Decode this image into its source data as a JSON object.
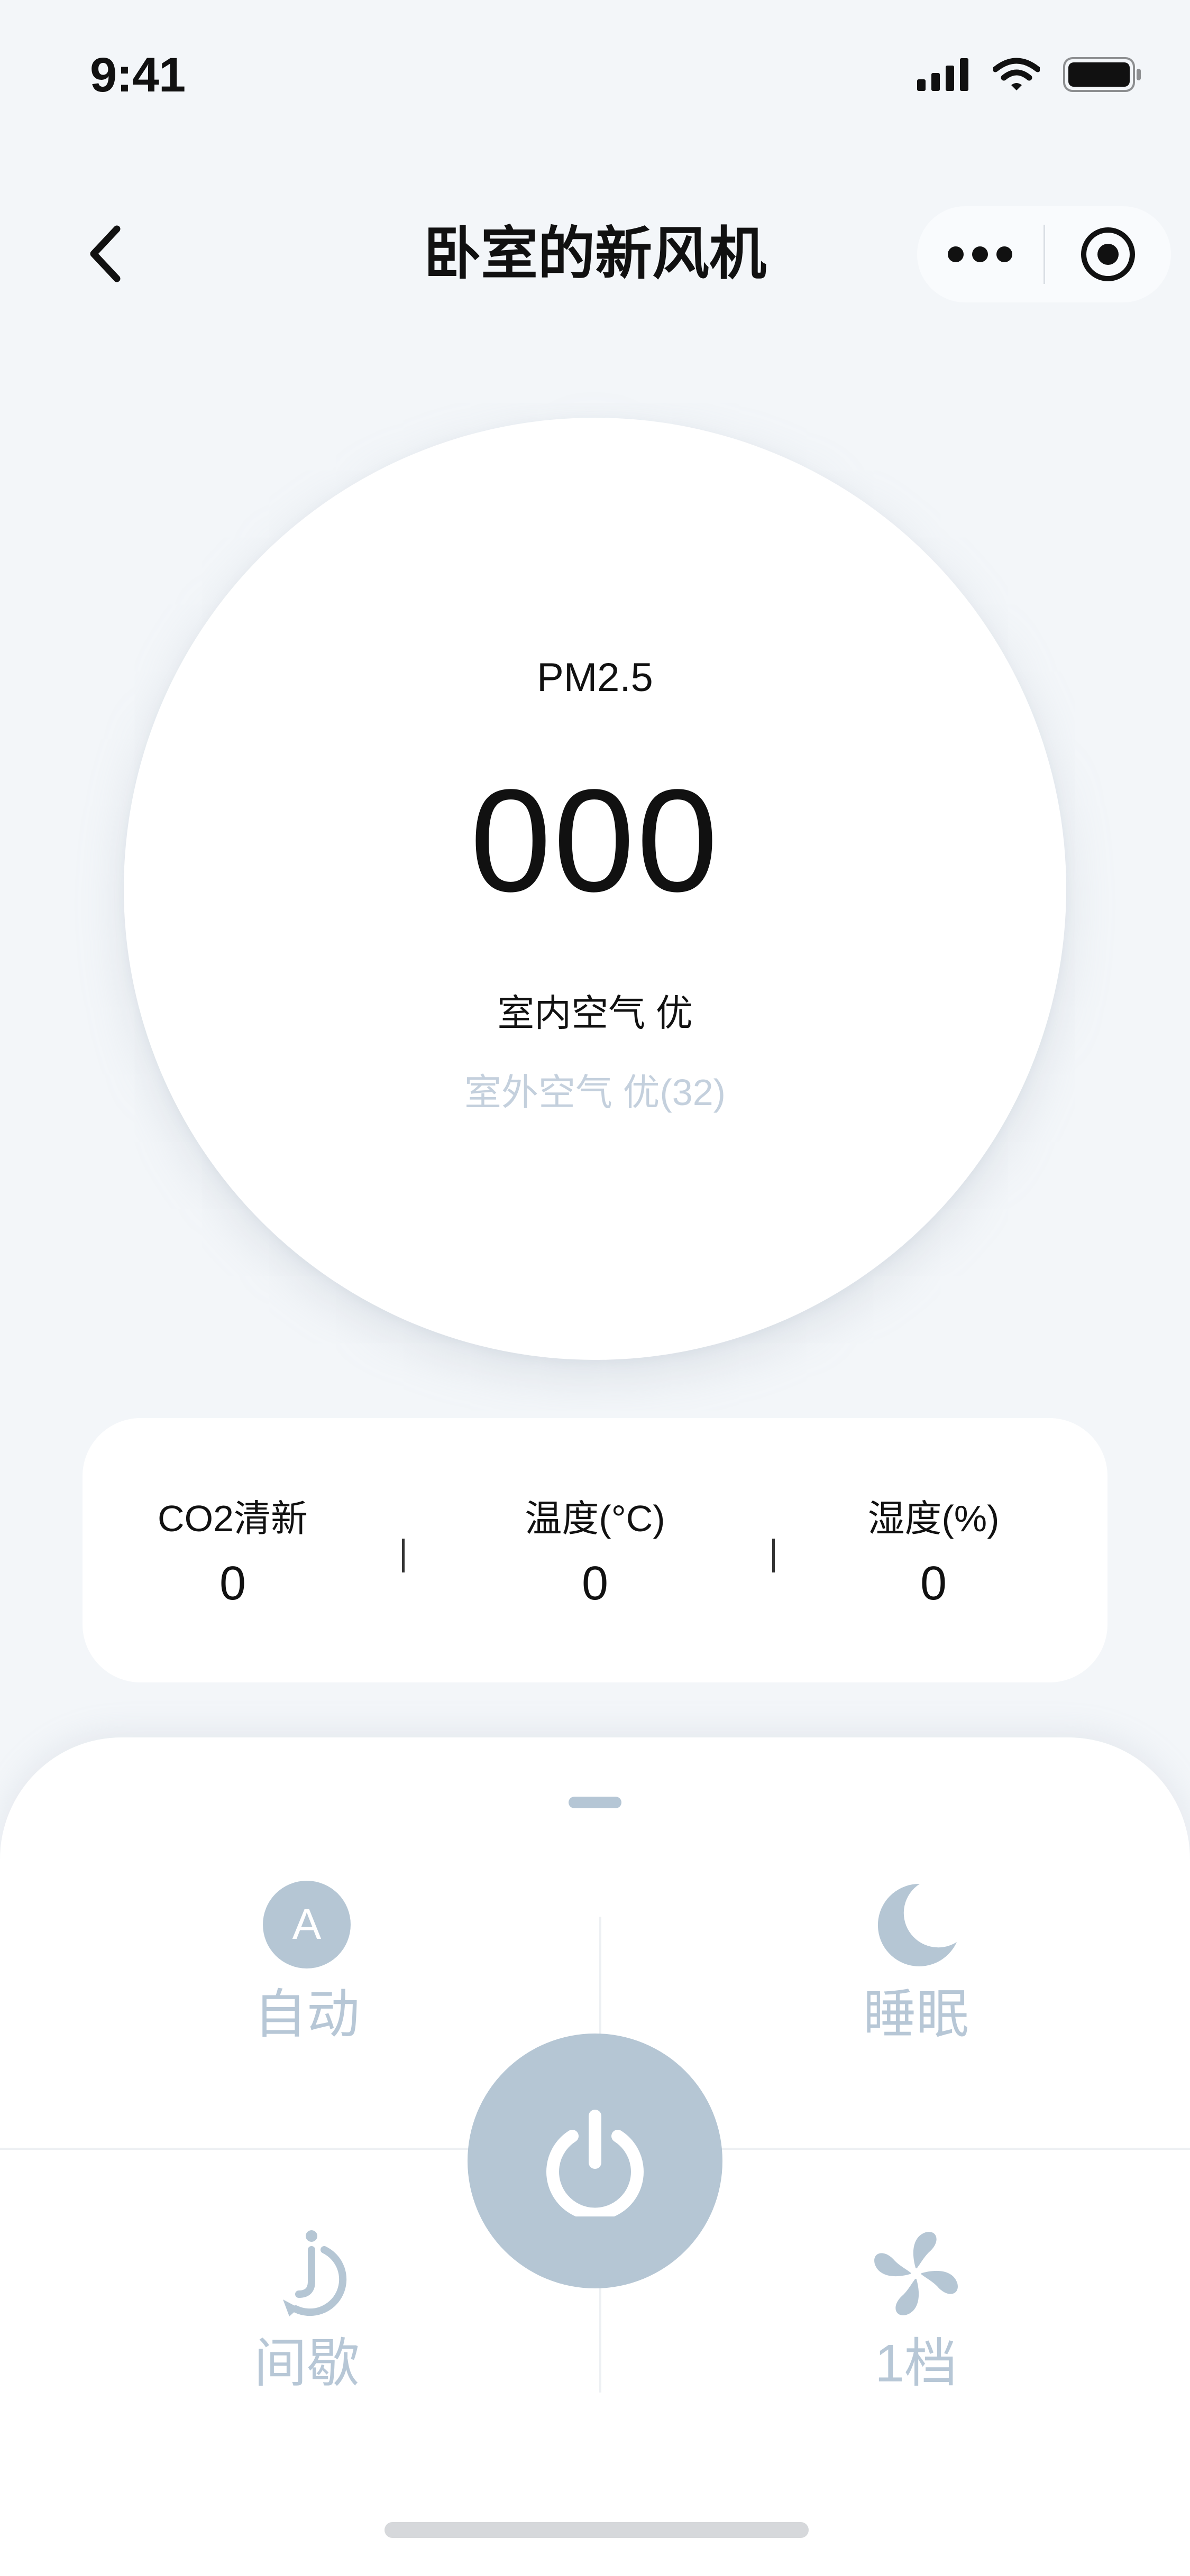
{
  "status_bar": {
    "time": "9:41"
  },
  "nav": {
    "title": "卧室的新风机"
  },
  "pm": {
    "label": "PM2.5",
    "value": "000",
    "indoor": "室内空气  优",
    "outdoor": "室外空气  优(32)"
  },
  "stats": [
    {
      "label": "CO2清新",
      "value": "0"
    },
    {
      "label": "温度(°C)",
      "value": "0"
    },
    {
      "label": "湿度(%)",
      "value": "0"
    }
  ],
  "modes": {
    "auto": {
      "label": "自动",
      "icon": "auto-icon",
      "glyph": "A"
    },
    "sleep": {
      "label": "睡眠",
      "icon": "moon-icon"
    },
    "intermittent": {
      "label": "间歇",
      "icon": "timer-icon"
    },
    "speed": {
      "label": "1档",
      "icon": "fan-icon"
    }
  },
  "colors": {
    "background": "#f3f6f9",
    "accent_muted": "#b5c6d4",
    "text_primary": "#111111",
    "text_muted": "#c4d0dd"
  }
}
